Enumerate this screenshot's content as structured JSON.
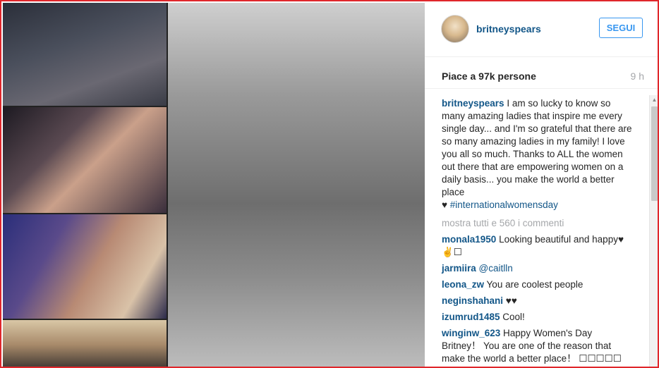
{
  "post": {
    "username": "britneyspears",
    "follow_label": "SEGUI",
    "likes": "Piace a 97k persone",
    "time_ago": "9 h",
    "caption_user": "britneyspears",
    "caption_text": "I am so lucky to know so many amazing ladies that inspire me every single day... and I'm so grateful that there are so many amazing ladies in my family! I love you all so much. Thanks to ALL the women out there that are empowering women on a daily basis... you make the world a better place",
    "caption_heart": "♥",
    "caption_hashtag": "#internationalwomensday",
    "show_all_comments": "mostra tutti e 560 i commenti"
  },
  "comments": [
    {
      "user": "monala1950",
      "text": "Looking beautiful and happy♥✌☐"
    },
    {
      "user": "jarmiira",
      "text": "@caitlln"
    },
    {
      "user": "leona_zw",
      "text": "You are coolest people"
    },
    {
      "user": "neginshahani",
      "text": "♥♥"
    },
    {
      "user": "izumrud1485",
      "text": "Cool!"
    },
    {
      "user": "winginw_623",
      "text": "Happy Women's Day Britney！ You are one of the reason that make the world a better place！ ☐☐☐☐☐"
    }
  ],
  "colors": {
    "frame_border": "#e0262b",
    "username": "#125688",
    "follow_button": "#3897f0",
    "muted_text": "#a5a7aa"
  }
}
